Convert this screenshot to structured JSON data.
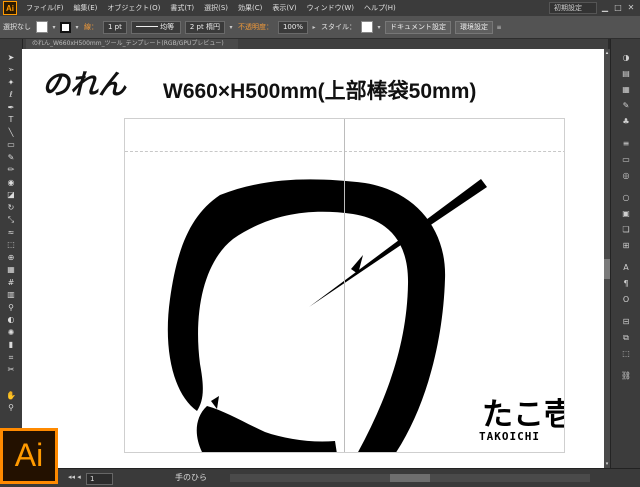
{
  "app": {
    "name": "Adobe Illustrator",
    "logo_text": "Ai",
    "badge_text": "Ai"
  },
  "menubar": {
    "items": [
      "ファイル(F)",
      "編集(E)",
      "オブジェクト(O)",
      "書式(T)",
      "選択(S)",
      "効果(C)",
      "表示(V)",
      "ウィンドウ(W)",
      "ヘルプ(H)"
    ],
    "workspace": "初期設定"
  },
  "controlbar": {
    "selection": "選択なし",
    "stroke_label": "線：",
    "stroke_weight": "1 pt",
    "profile": "均等",
    "brush": "2 pt 楕円",
    "opacity_label": "不透明度：",
    "opacity_value": "100%",
    "style_label": "スタイル：",
    "doc_settings_button": "ドキュメント設定",
    "preferences_button": "環境設定"
  },
  "document": {
    "tab_title": "のれん_W660xH500mm_ツール_テンプレート(RGB/GPUプレビュー)",
    "heading": "のれん",
    "dimension": "W660×H500mm(上部棒袋50mm)",
    "brand_jp": "たこ壱",
    "brand_en": "TAKOICHI"
  },
  "statusbar": {
    "zoom": "1",
    "status_text": "手のひら"
  },
  "icons": {
    "left_tools": [
      "selection-tool",
      "direct-selection-tool",
      "magic-wand-tool",
      "lasso-tool",
      "pen-tool",
      "type-tool",
      "line-tool",
      "rectangle-tool",
      "paintbrush-tool",
      "pencil-tool",
      "blob-brush-tool",
      "eraser-tool",
      "rotate-tool",
      "scale-tool",
      "warp-tool",
      "free-transform-tool",
      "shape-builder-tool",
      "perspective-grid-tool",
      "mesh-tool",
      "gradient-tool",
      "eyedropper-tool",
      "blend-tool",
      "symbol-sprayer-tool",
      "column-graph-tool",
      "artboard-tool",
      "slice-tool",
      "hand-tool",
      "zoom-tool"
    ],
    "right_panels": [
      "color-panel",
      "color-guide-panel",
      "swatches-panel",
      "brushes-panel",
      "symbols-panel",
      "stroke-panel",
      "gradient-panel",
      "transparency-panel",
      "appearance-panel",
      "graphic-styles-panel",
      "layers-panel",
      "artboards-panel",
      "character-panel",
      "paragraph-panel",
      "opentype-panel",
      "align-panel",
      "pathfinder-panel",
      "transform-panel",
      "links-panel"
    ]
  },
  "colors": {
    "accent": "#ff9a00",
    "ui_dark": "#535353",
    "canvas": "#ffffff"
  }
}
